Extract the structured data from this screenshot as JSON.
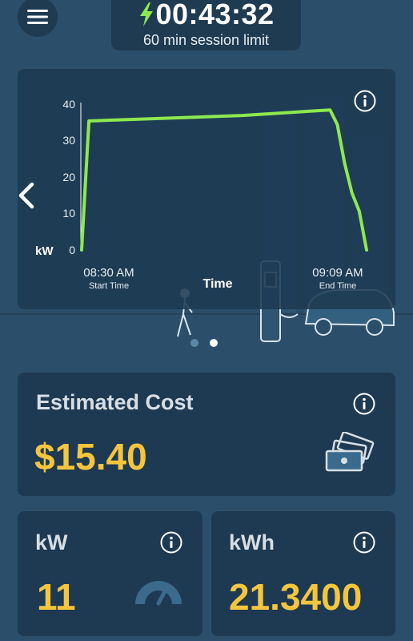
{
  "header": {
    "timer": "00:43:32",
    "session_limit": "60 min session limit"
  },
  "chart": {
    "y_ticks": [
      "40",
      "30",
      "20",
      "10",
      "0"
    ],
    "y_unit": "kW",
    "start_time": "08:30 AM",
    "start_caption": "Start Time",
    "end_time": "09:09 AM",
    "end_caption": "End Time",
    "x_label": "Time"
  },
  "chart_data": {
    "type": "line",
    "x": [
      "08:30",
      "08:31",
      "08:52",
      "09:04",
      "09:05",
      "09:06",
      "09:07",
      "09:08",
      "09:09"
    ],
    "y": [
      0,
      35,
      36.5,
      38,
      34,
      23.5,
      15.5,
      10.5,
      0
    ],
    "ylabel": "kW",
    "xlabel": "Time",
    "ylim": [
      0,
      40
    ],
    "color": "#8ee84f"
  },
  "pagination": {
    "count": 2,
    "active": 1
  },
  "cost_card": {
    "label": "Estimated Cost",
    "value": "$15.40"
  },
  "kw_card": {
    "label": "kW",
    "value": "11"
  },
  "kwh_card": {
    "label": "kWh",
    "value": "21.3400"
  },
  "colors": {
    "background": "#2b4f6b",
    "card": "#1e3a52",
    "accent_value": "#f5c53d",
    "line": "#8ee84f"
  },
  "icons": {
    "menu": "hamburger-icon",
    "timer": "lightning-bolt-icon",
    "info": "info-icon",
    "prev": "chevron-left-icon",
    "cost": "cash-icon",
    "kw": "speedometer-icon"
  }
}
